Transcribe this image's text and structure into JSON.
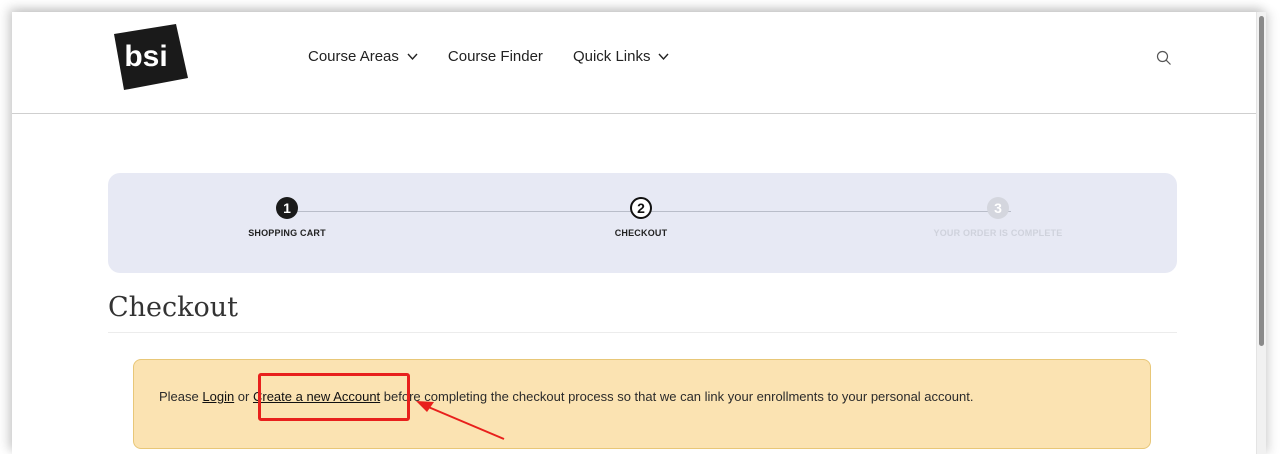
{
  "header": {
    "logo_text": "bsi",
    "nav": [
      {
        "label": "Course Areas",
        "has_dropdown": true
      },
      {
        "label": "Course Finder",
        "has_dropdown": false
      },
      {
        "label": "Quick Links",
        "has_dropdown": true
      }
    ],
    "search_icon": "search-icon"
  },
  "steps": [
    {
      "number": "1",
      "label": "SHOPPING CART",
      "state": "done"
    },
    {
      "number": "2",
      "label": "CHECKOUT",
      "state": "current"
    },
    {
      "number": "3",
      "label": "YOUR ORDER IS COMPLETE",
      "state": "pending"
    }
  ],
  "page": {
    "title": "Checkout"
  },
  "notice": {
    "prefix": "Please ",
    "login_link": "Login",
    "or": " or ",
    "create_link": "Create a new Account",
    "suffix": " before completing the checkout process so that we can link your enrollments to your personal account."
  },
  "colors": {
    "step_bar": "#e7e9f4",
    "notice_bg": "#fbe3b2",
    "notice_border": "#e8c778",
    "highlight": "#e8201c"
  }
}
